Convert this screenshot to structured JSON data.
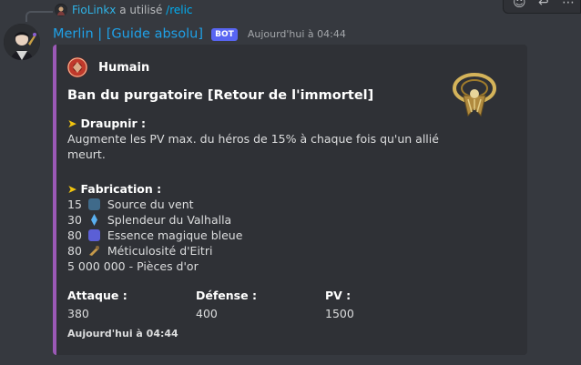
{
  "reply": {
    "user": "FioLinkx",
    "action": "a utilisé",
    "command": "/relic"
  },
  "message": {
    "username": "Merlin | [Guide absolu]",
    "bot_badge": "BOT",
    "timestamp": "Aujourd'hui à 04:44"
  },
  "embed": {
    "accent_color": "#9b59b6",
    "author": "Humain",
    "title": "Ban du purgatoire [Retour de l'immortel]",
    "sections": {
      "draupnir_title": "Draupnir :",
      "draupnir_text_1": "Augmente les PV max. du héros de 15% à chaque fois qu'un allié",
      "draupnir_text_2": "meurt.",
      "fabrication_title": "Fabrication :",
      "materials": [
        {
          "qty": "15",
          "icon": "wind-stone-icon",
          "name": "Source du vent"
        },
        {
          "qty": "30",
          "icon": "valhalla-crystal-icon",
          "name": "Splendeur du Valhalla"
        },
        {
          "qty": "80",
          "icon": "blue-magic-cube-icon",
          "name": "Essence magique bleue"
        },
        {
          "qty": "80",
          "icon": "eitri-tool-icon",
          "name": "Méticulosité d'Eitri"
        }
      ],
      "gold": "5 000 000 - Pièces d'or"
    },
    "fields": [
      {
        "name": "Attaque :",
        "value": "380"
      },
      {
        "name": "Défense :",
        "value": "400"
      },
      {
        "name": "PV :",
        "value": "1500"
      }
    ],
    "footer": "Aujourd'hui à 04:44"
  }
}
